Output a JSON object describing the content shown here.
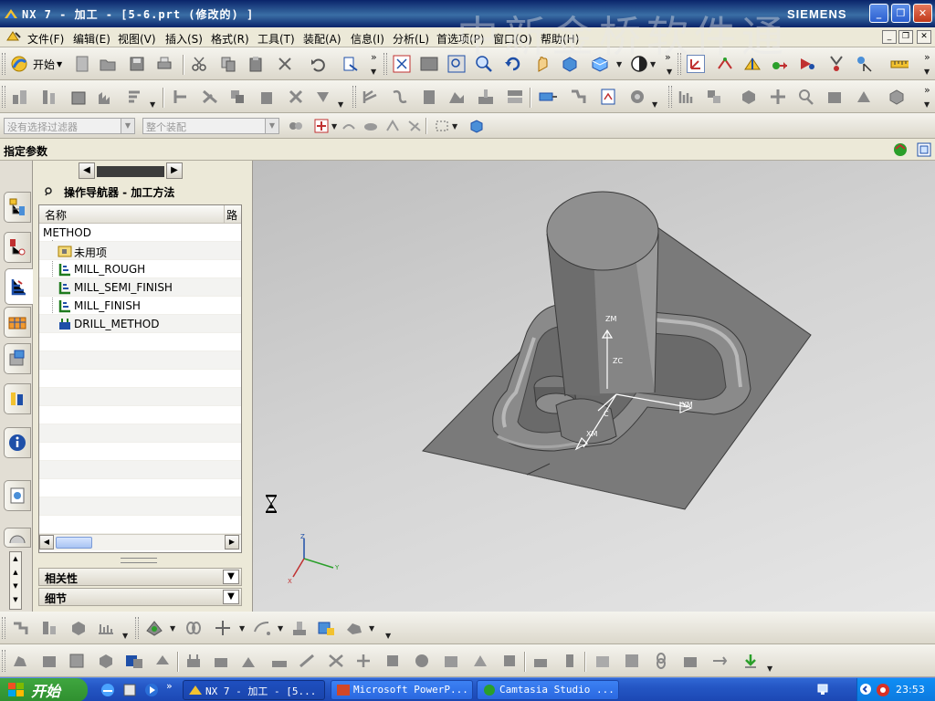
{
  "window": {
    "title": "NX 7 - 加工 - [5-6.prt  (修改的) ]",
    "brand": "SIEMENS",
    "watermark": "中新金桥软件通"
  },
  "menu": {
    "items": [
      "文件(F)",
      "编辑(E)",
      "视图(V)",
      "插入(S)",
      "格式(R)",
      "工具(T)",
      "装配(A)",
      "信息(I)",
      "分析(L)",
      "首选项(P)",
      "窗口(O)",
      "帮助(H)"
    ]
  },
  "toolbar": {
    "start_label": "开始"
  },
  "selection_bar": {
    "filter_value": "没有选择过滤器",
    "scope_value": "整个装配"
  },
  "cue_line": {
    "text": "指定参数"
  },
  "navigator": {
    "title": "操作导航器 - 加工方法",
    "columns": [
      "名称",
      "路"
    ],
    "rows": [
      {
        "label": "METHOD",
        "icon": "none"
      },
      {
        "label": "未用项",
        "icon": "unused-folder-icon"
      },
      {
        "label": "MILL_ROUGH",
        "icon": "mill-method-icon"
      },
      {
        "label": "MILL_SEMI_FINISH",
        "icon": "mill-method-icon"
      },
      {
        "label": "MILL_FINISH",
        "icon": "mill-method-icon"
      },
      {
        "label": "DRILL_METHOD",
        "icon": "drill-method-icon"
      }
    ],
    "panels": [
      "相关性",
      "细节"
    ]
  },
  "viewport": {
    "axis_labels": {
      "z": "Z",
      "x": "X",
      "y": "Y"
    },
    "model_labels": {
      "zm": "ZM",
      "zc": "ZC",
      "xm": "XM",
      "xc": "C",
      "ym": "YM"
    },
    "cursor": "hourglass-icon"
  },
  "taskbar": {
    "start_label": "开始",
    "tasks": [
      "NX 7 - 加工 - [5...",
      "Microsoft PowerP...",
      "Camtasia Studio ..."
    ],
    "clock": "23:53"
  },
  "colors": {
    "title_bar": "#0a246a",
    "taskbar": "#2456c4",
    "start_button": "#3fa63f",
    "model_gray": "#6e6e6e"
  }
}
